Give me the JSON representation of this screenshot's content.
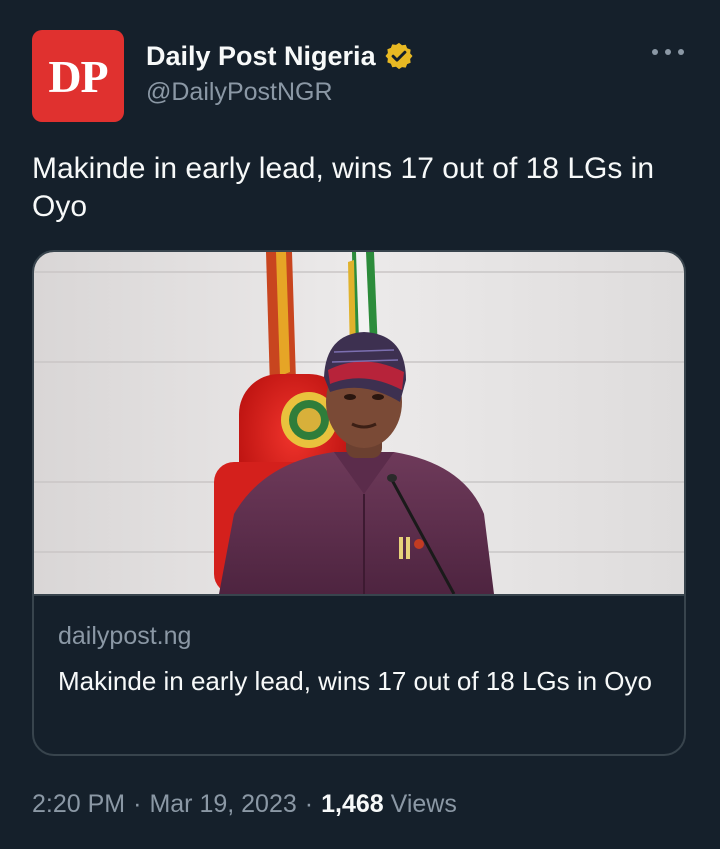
{
  "author": {
    "avatar_text": "DP",
    "display_name": "Daily Post Nigeria",
    "handle": "@DailyPostNGR",
    "verified_icon": "verified-badge-icon",
    "brand_color": "#e0312f"
  },
  "tweet": {
    "text": "Makinde in early lead, wins 17 out of 18 LGs in Oyo"
  },
  "card": {
    "domain": "dailypost.ng",
    "title": "Makinde in early lead, wins 17 out of 18 LGs in Oyo",
    "image_icon": "news-photo-image"
  },
  "meta": {
    "time": "2:20 PM",
    "separator": "·",
    "date": "Mar 19, 2023",
    "views_count": "1,468",
    "views_label": "Views"
  },
  "colors": {
    "background": "#15202b",
    "text_primary": "#f7f9f9",
    "text_secondary": "#8b98a5",
    "border": "#38444d",
    "verified_gold": "#e8b923"
  }
}
